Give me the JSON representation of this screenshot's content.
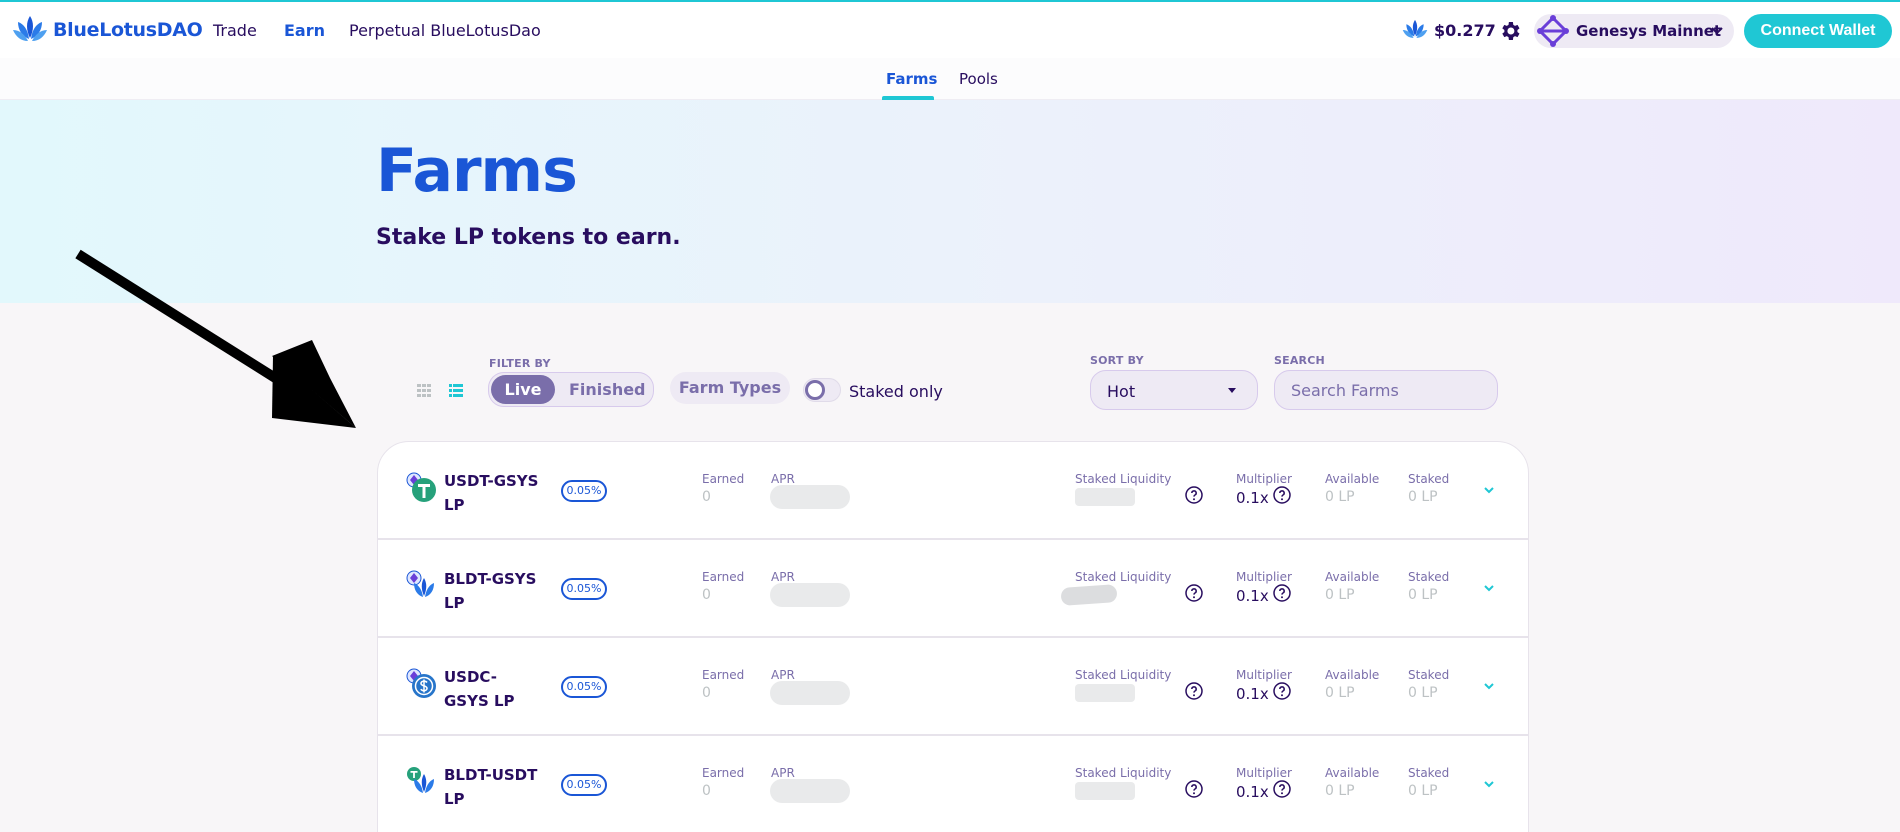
{
  "header": {
    "brand": "BlueLotusDAO",
    "nav": [
      "Trade",
      "Earn",
      "Perpetual BlueLotusDao"
    ],
    "active_nav": "Earn",
    "token_price": "$0.277",
    "network": "Genesys Mainnet",
    "connect_label": "Connect Wallet"
  },
  "subnav": {
    "tabs": [
      "Farms",
      "Pools"
    ],
    "active": "Farms"
  },
  "hero": {
    "title": "Farms",
    "subtitle": "Stake LP tokens to earn."
  },
  "filters": {
    "filter_by_label": "FILTER BY",
    "live_label": "Live",
    "finished_label": "Finished",
    "farm_types_label": "Farm Types",
    "staked_only_label": "Staked only",
    "staked_only_on": false,
    "sort_by_label": "SORT BY",
    "sort_value": "Hot",
    "search_label": "SEARCH",
    "search_placeholder": "Search Farms"
  },
  "columns": {
    "earned": "Earned",
    "apr": "APR",
    "staked_liquidity": "Staked Liquidity",
    "multiplier": "Multiplier",
    "available": "Available",
    "staked": "Staked"
  },
  "farms": [
    {
      "name": "USDT-GSYS LP",
      "fee": "0.05%",
      "earned": "0",
      "multiplier": "0.1x",
      "available": "0 LP",
      "staked": "0 LP",
      "icon": "tether-icon"
    },
    {
      "name": "BLDT-GSYS LP",
      "fee": "0.05%",
      "earned": "0",
      "multiplier": "0.1x",
      "available": "0 LP",
      "staked": "0 LP",
      "icon": "lotus-icon"
    },
    {
      "name": "USDC-GSYS LP",
      "fee": "0.05%",
      "earned": "0",
      "multiplier": "0.1x",
      "available": "0 LP",
      "staked": "0 LP",
      "icon": "usdc-icon"
    },
    {
      "name": "BLDT-USDT LP",
      "fee": "0.05%",
      "earned": "0",
      "multiplier": "0.1x",
      "available": "0 LP",
      "staked": "0 LP",
      "icon": "lotus-icon"
    }
  ],
  "colors": {
    "primary_blue": "#1a56d6",
    "accent_cyan": "#1fc7d4",
    "text_dark": "#280d5f",
    "text_muted": "#7a6eaa",
    "tether_green": "#26a17b"
  }
}
